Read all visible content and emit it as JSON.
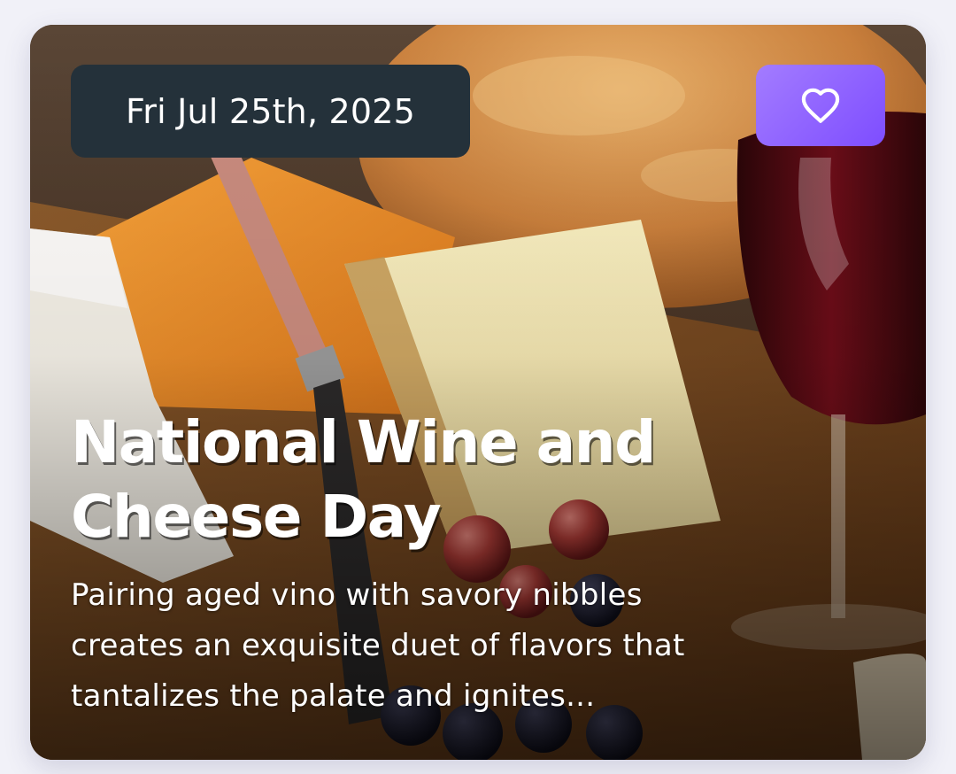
{
  "card": {
    "date": "Fri Jul 25th, 2025",
    "title_line1": "National Wine and",
    "title_line2": "Cheese Day",
    "description_line1": "Pairing aged vino with savory nibbles",
    "description_line2": "creates an exquisite duet of flavors that",
    "description_line3": "tantalizes the palate and ignites...",
    "favorite_icon": "heart-outline-icon",
    "image_subject": "wine-and-cheese-board"
  },
  "colors": {
    "page_background": "#f1f1f8",
    "date_pill": "#24313a",
    "favorite_gradient_start": "#a37cff",
    "favorite_gradient_end": "#7e4dff",
    "text": "#ffffff"
  }
}
